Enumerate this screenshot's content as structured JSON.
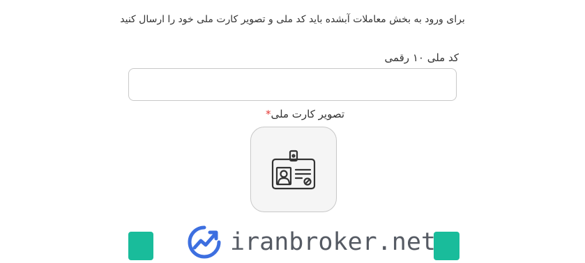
{
  "intro": {
    "text": "برای ورود به بخش معاملات آبشده باید کد ملی و تصویر کارت ملی خود را ارسال کنید"
  },
  "national_code": {
    "label": "کد ملی ۱۰ رقمی",
    "value": "",
    "placeholder": ""
  },
  "id_card": {
    "label": "تصویر کارت ملی",
    "required_mark": "*",
    "icon": "id-card-icon"
  },
  "watermark": {
    "text": "iranbroker.net",
    "icon": "trend-chart-logo-icon"
  },
  "colors": {
    "accent": "#19bc9b",
    "required": "#e53935",
    "border": "#c8c8c8",
    "text": "#333333"
  }
}
